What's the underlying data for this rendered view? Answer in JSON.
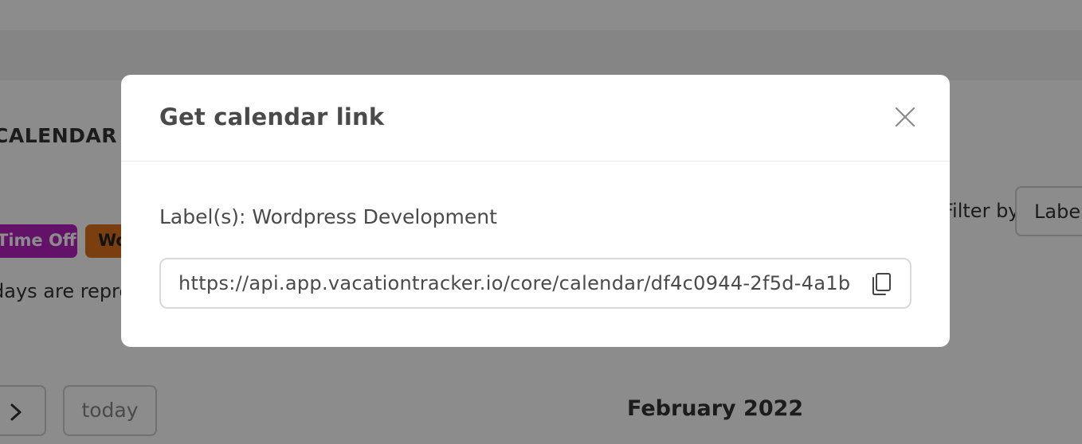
{
  "background": {
    "calendar_heading": "CALENDAR",
    "tags": [
      "Time Off",
      "Work"
    ],
    "description_fragment": "days are represented",
    "filter_label": "Filter by",
    "filter_value": "Labels",
    "today_label": "today",
    "month_title": "February 2022",
    "icons": {
      "next": "chevron-right-icon"
    }
  },
  "modal": {
    "title": "Get calendar link",
    "label_text": "Label(s): Wordpress Development",
    "link_value": "https://api.app.vacationtracker.io/core/calendar/df4c0944-2f5d-4a1b",
    "icons": {
      "close": "close-icon",
      "copy": "copy-icon"
    }
  },
  "colors": {
    "overlay": "rgba(0,0,0,0.45)",
    "tag_purple": "#b41fc0",
    "tag_orange": "#e0741c",
    "title_text": "#4a4a4a"
  }
}
